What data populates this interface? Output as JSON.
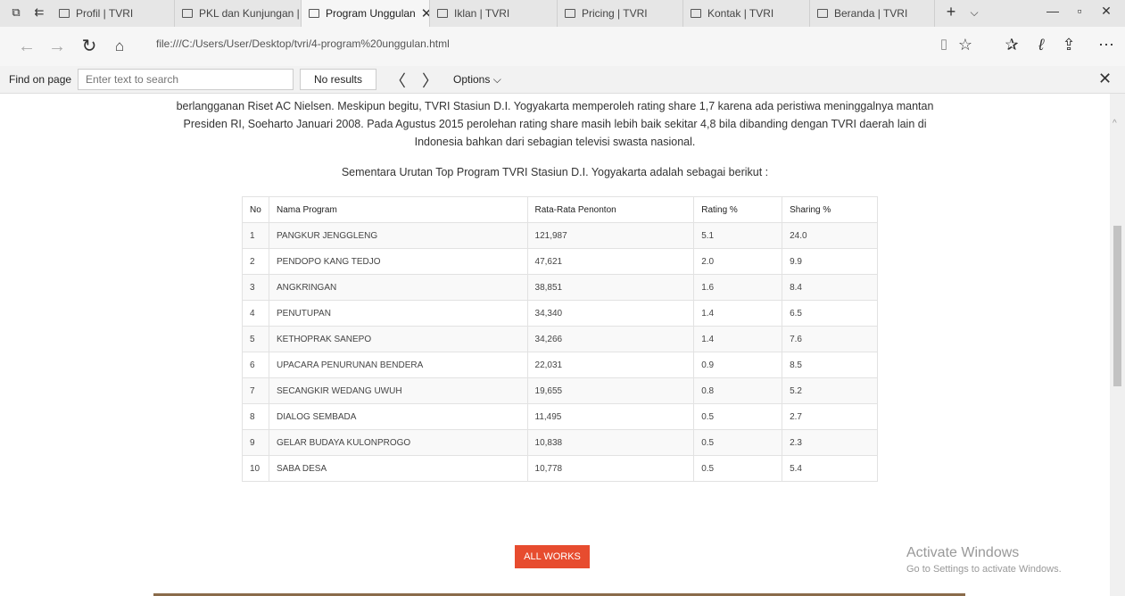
{
  "tabs": [
    {
      "label": "Profil | TVRI",
      "active": false
    },
    {
      "label": "PKL dan Kunjungan | TV",
      "active": false
    },
    {
      "label": "Program Unggulan",
      "active": true
    },
    {
      "label": "Iklan | TVRI",
      "active": false
    },
    {
      "label": "Pricing | TVRI",
      "active": false
    },
    {
      "label": "Kontak | TVRI",
      "active": false
    },
    {
      "label": "Beranda | TVRI",
      "active": false
    }
  ],
  "address": {
    "url": "file:///C:/Users/User/Desktop/tvri/4-program%20unggulan.html"
  },
  "find": {
    "label": "Find on page",
    "placeholder": "Enter text to search",
    "results": "No results",
    "options": "Options"
  },
  "content": {
    "paragraph_lines": [
      "berlangganan Riset AC Nielsen. Meskipun begitu, TVRI Stasiun D.I. Yogyakarta memperoleh rating share 1,7 karena ada peristiwa meninggalnya mantan",
      "Presiden RI, Soeharto Januari 2008. Pada Agustus 2015 perolehan rating share masih lebih baik sekitar 4,8 bila dibanding dengan TVRI daerah lain di",
      "Indonesia bahkan dari sebagian televisi swasta nasional."
    ],
    "intro": "Sementara Urutan Top Program TVRI Stasiun D.I. Yogyakarta adalah sebagai berikut :",
    "table": {
      "headers": [
        "No",
        "Nama Program",
        "Rata-Rata Penonton",
        "Rating %",
        "Sharing %"
      ],
      "rows": [
        [
          "1",
          "PANGKUR JENGGLENG",
          "121,987",
          "5.1",
          "24.0"
        ],
        [
          "2",
          "PENDOPO KANG TEDJO",
          "47,621",
          "2.0",
          "9.9"
        ],
        [
          "3",
          "ANGKRINGAN",
          "38,851",
          "1.6",
          "8.4"
        ],
        [
          "4",
          "PENUTUPAN",
          "34,340",
          "1.4",
          "6.5"
        ],
        [
          "5",
          "KETHOPRAK SANEPO",
          "34,266",
          "1.4",
          "7.6"
        ],
        [
          "6",
          "UPACARA PENURUNAN BENDERA",
          "22,031",
          "0.9",
          "8.5"
        ],
        [
          "7",
          "SECANGKIR WEDANG UWUH",
          "19,655",
          "0.8",
          "5.2"
        ],
        [
          "8",
          "DIALOG SEMBADA",
          "11,495",
          "0.5",
          "2.7"
        ],
        [
          "9",
          "GELAR BUDAYA KULONPROGO",
          "10,838",
          "0.5",
          "2.3"
        ],
        [
          "10",
          "SABA DESA",
          "10,778",
          "0.5",
          "5.4"
        ]
      ]
    },
    "all_works": "ALL WORKS"
  },
  "watermark": {
    "title": "Activate Windows",
    "subtitle": "Go to Settings to activate Windows."
  },
  "colors": {
    "accent_button": "#e74c2f"
  }
}
